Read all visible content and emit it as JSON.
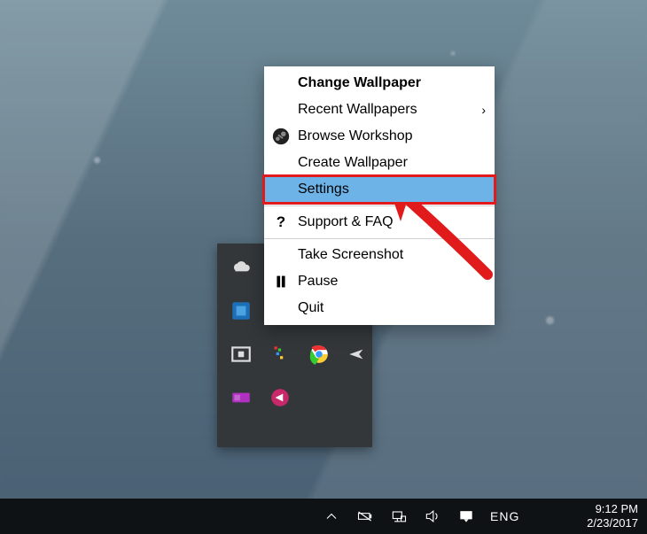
{
  "context_menu": {
    "items": [
      {
        "label": "Change Wallpaper",
        "bold": true
      },
      {
        "label": "Recent Wallpapers",
        "submenu": true
      },
      {
        "label": "Browse Workshop",
        "icon": "steam"
      },
      {
        "label": "Create Wallpaper"
      },
      {
        "label": "Settings",
        "highlighted": true
      },
      {
        "sep": true
      },
      {
        "label": "Support & FAQ",
        "icon": "question"
      },
      {
        "sep": true
      },
      {
        "label": "Take Screenshot"
      },
      {
        "label": "Pause",
        "icon": "pause"
      },
      {
        "label": "Quit"
      }
    ]
  },
  "tray_panel": {
    "icons": [
      "onedrive",
      "intel",
      "wallpaper-engine",
      "pixel-app",
      "chrome",
      "jet",
      "recorder",
      "circle-app"
    ]
  },
  "taskbar": {
    "icons": [
      "tray-chevron",
      "battery",
      "network",
      "volume",
      "action-center"
    ],
    "lang": "ENG",
    "time": "9:12 PM",
    "date": "2/23/2017"
  }
}
